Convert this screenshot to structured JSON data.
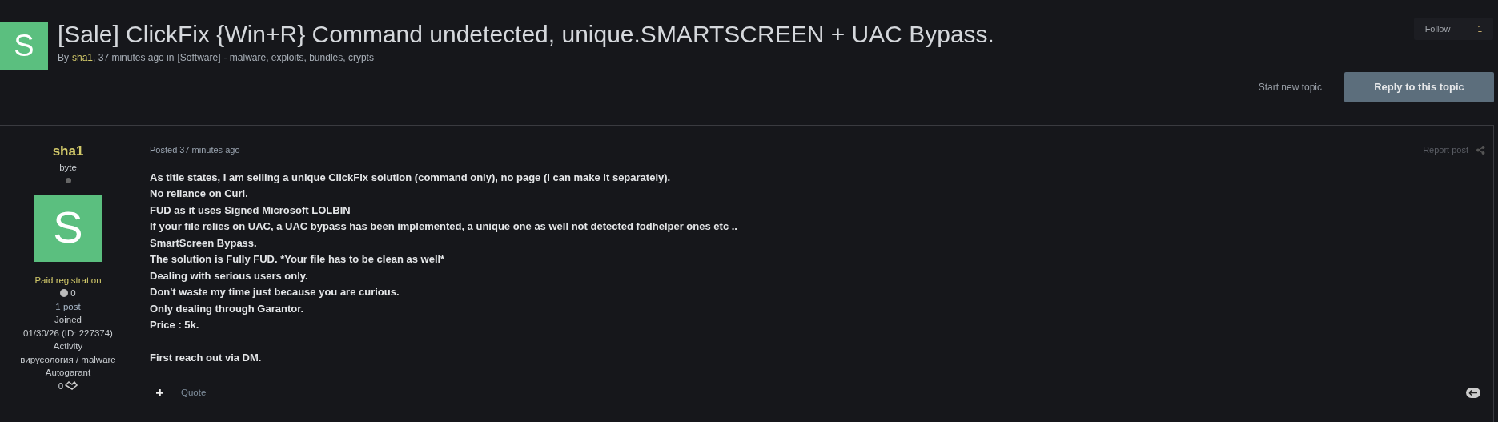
{
  "topic": {
    "avatar_letter": "S",
    "title": "[Sale] ClickFix {Win+R} Command undetected, unique.SMARTSCREEN + UAC Bypass.",
    "by": "By",
    "author": "sha1",
    "time": ", 37 minutes ago in",
    "forum": "[Software]",
    "forum_desc": "- malware, exploits, bundles, crypts",
    "follow": {
      "label": "Follow",
      "count": "1"
    }
  },
  "actions": {
    "start_new_topic": "Start new topic",
    "reply": "Reply to this topic"
  },
  "post": {
    "author": {
      "name": "sha1",
      "rank": "byte",
      "online": false,
      "avatar_letter": "S",
      "group": "Paid registration",
      "reputation": "0",
      "posts": "1 post",
      "joined_label": "Joined",
      "joined": "01/30/26 (ID: 227374)",
      "activity_label": "Activity",
      "activity": "вирусология / malware",
      "autogarant_label": "Autogarant",
      "autogarant": "0"
    },
    "posted": "Posted 37 minutes ago",
    "report": "Report post",
    "paragraphs": [
      [
        "As title states, I am selling a unique ClickFix solution (command only), no page (I can make it separately).",
        "No reliance on Curl.",
        "FUD as it uses Signed Microsoft LOLBIN",
        "If your file relies on UAC, a UAC bypass has been implemented, a unique one as well not detected fodhelper ones etc ..",
        "SmartScreen Bypass.",
        "The solution is Fully FUD. *Your file has to be clean as well*",
        "Dealing with serious users only.",
        "Don't waste my time just because you are curious.",
        "Only dealing through Garantor.",
        "Price : 5k."
      ],
      [
        "First reach out via DM."
      ]
    ],
    "quote": "Quote"
  }
}
